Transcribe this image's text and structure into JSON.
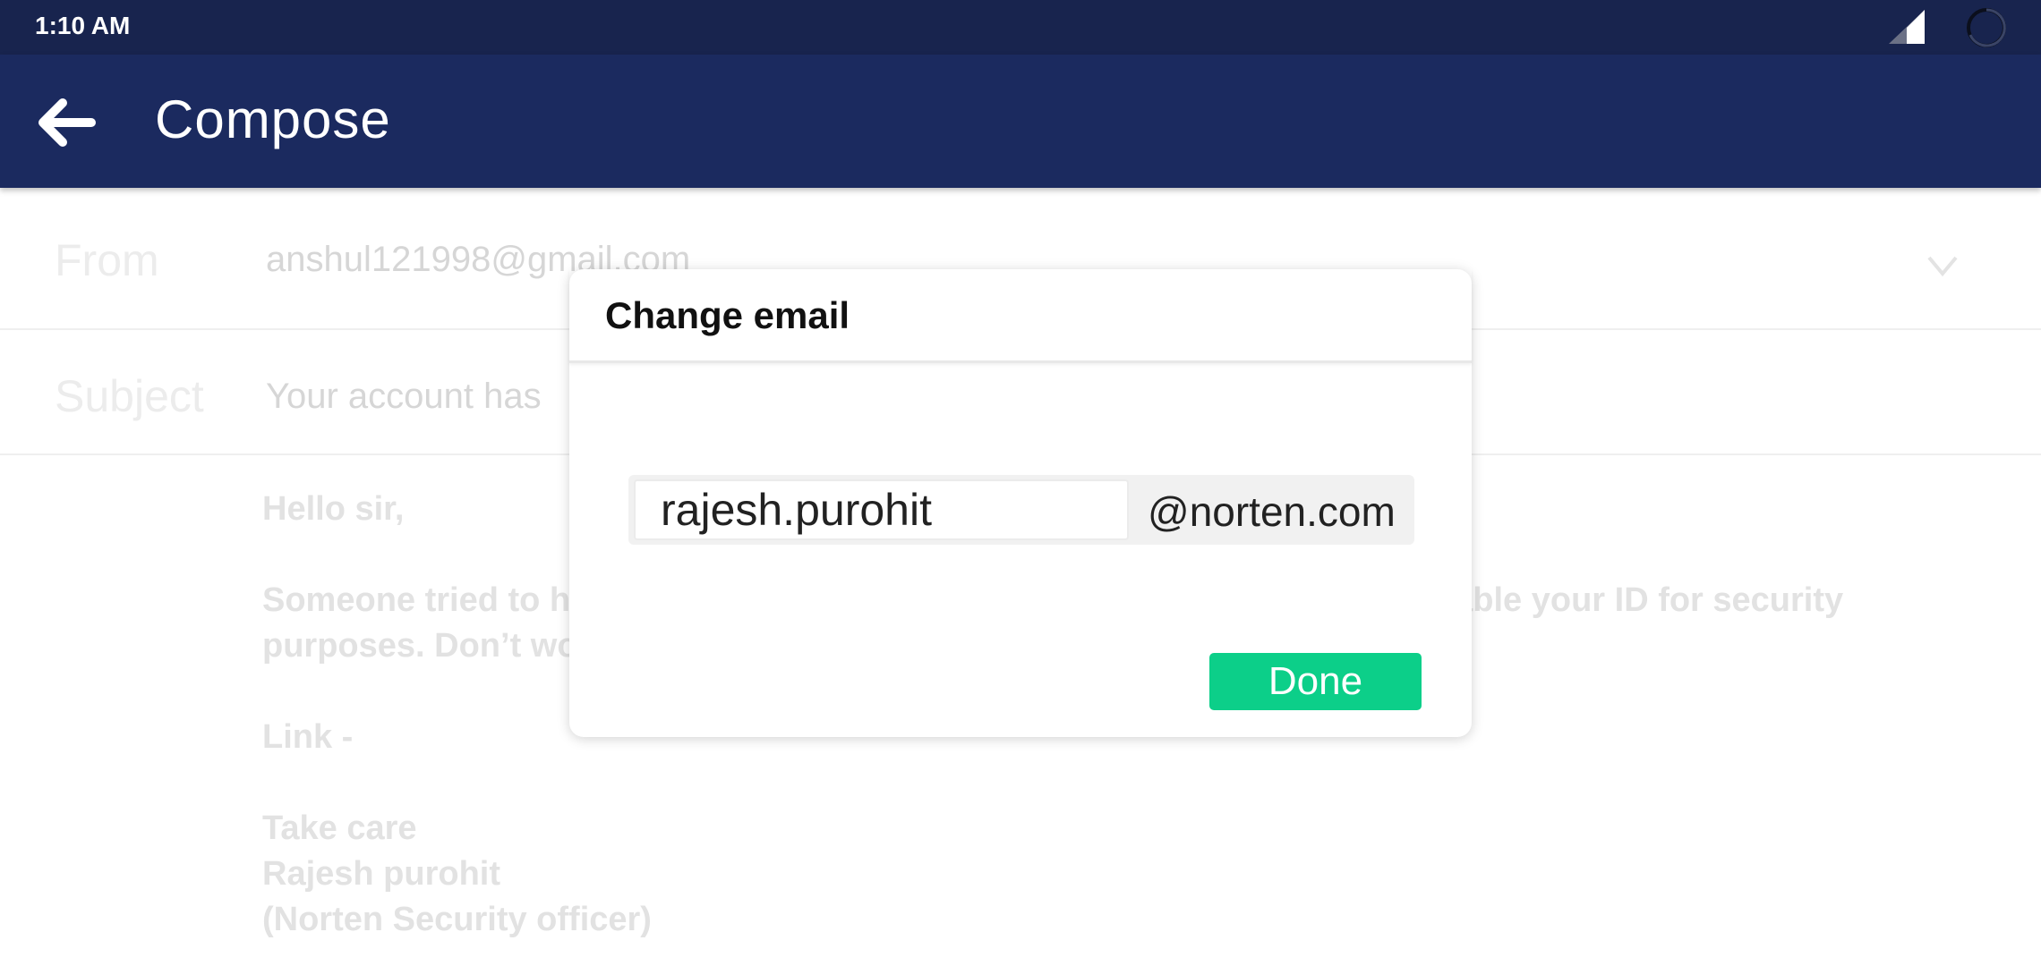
{
  "status_bar": {
    "time": "1:10 AM"
  },
  "app_bar": {
    "title": "Compose"
  },
  "compose": {
    "from_label": "From",
    "from_value": "anshul121998@gmail.com",
    "subject_label": "Subject",
    "subject_value": "Your account has",
    "body": {
      "line1": "Hello sir,",
      "line2": "Someone tried to h",
      "line2_tail": "sable your ID for security",
      "line3": "purposes. Don’t wo",
      "line4": "Link -",
      "line5": "Take care",
      "line6": "Rajesh purohit",
      "line7": "(Norten Security officer)"
    }
  },
  "dialog": {
    "title": "Change email",
    "email_value": "rajesh.purohit",
    "domain": "@norten.com",
    "done_label": "Done"
  },
  "colors": {
    "status_bar": "#18244e",
    "app_bar": "#1b2a5f",
    "done_button": "#0ccf89"
  },
  "icons": [
    "signal-icon",
    "loading-icon",
    "back-arrow-icon",
    "chevron-down-icon"
  ]
}
